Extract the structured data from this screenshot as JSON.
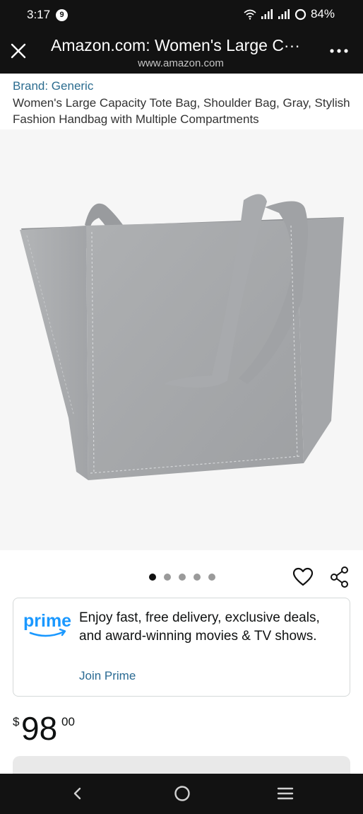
{
  "status_bar": {
    "time": "3:17",
    "notification_count": "9",
    "battery": "84%",
    "icons": [
      "wifi-icon",
      "signal-icon",
      "signal-icon",
      "ring-icon"
    ]
  },
  "app_bar": {
    "title": "Amazon.com: Women's Large C···",
    "url": "www.amazon.com",
    "close_icon": "close-icon",
    "menu_icon": "more-options-icon"
  },
  "product": {
    "brand": "Brand: Generic",
    "title": "Women's Large Capacity Tote Bag, Shoulder Bag, Gray, Stylish Fashion Handbag with Multiple Compartments",
    "image_icon": "gray-tote-bag-image",
    "image_count": 5,
    "active_image_index": 0
  },
  "actions": {
    "wishlist_icon": "heart-icon",
    "share_icon": "share-icon"
  },
  "prime": {
    "logo_text": "prime",
    "message": "Enjoy fast, free delivery, exclusive deals, and award-winning movies & TV shows.",
    "join_label": "Join Prime"
  },
  "price": {
    "symbol": "$",
    "whole": "98",
    "fraction": "00"
  },
  "nav": {
    "back_icon": "back-icon",
    "home_icon": "home-icon",
    "recents_icon": "recents-icon"
  },
  "colors": {
    "system_bar": "#121212",
    "link": "#2b6c8f",
    "prime_blue": "#1a98ff",
    "bag_gray": "#a7a9ab"
  }
}
